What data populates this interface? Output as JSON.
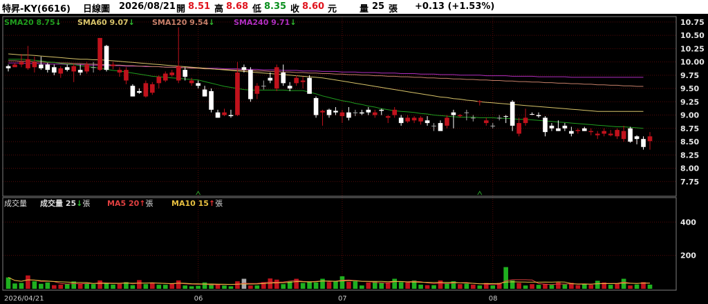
{
  "header": {
    "name": "特昇-KY(6616)",
    "chart_kind": "日線圖",
    "date": "2026/08/21",
    "open_label": "開",
    "open": "8.51",
    "high_label": "高",
    "high": "8.68",
    "low_label": "低",
    "low": "8.35",
    "close_label": "收",
    "close": "8.60",
    "unit": "元",
    "volume_label": "量",
    "volume": "25",
    "volume_unit": "張",
    "change": "+0.13 (+1.53%)"
  },
  "colors": {
    "up": "#c0121c",
    "down": "#ffffff",
    "flat": "#aaaaaa",
    "vol_up": "#c0121c",
    "vol_down": "#1fb01f",
    "sma20": "#1f9e1f",
    "sma60": "#d8c46a",
    "sma120": "#c8806a",
    "sma240": "#b02ec0",
    "ma5": "#e04040",
    "ma10": "#e8c040",
    "grid": "#5a0a0a",
    "frame": "#808080"
  },
  "legend_price": [
    {
      "label": "SMA20",
      "value": "8.75",
      "arrow": "down"
    },
    {
      "label": "SMA60",
      "value": "9.07",
      "arrow": "down"
    },
    {
      "label": "SMA120",
      "value": "9.54",
      "arrow": "down"
    },
    {
      "label": "SMA240",
      "value": "9.71",
      "arrow": "down"
    }
  ],
  "legend_volume": {
    "title": "成交量",
    "items": [
      {
        "label": "成交量",
        "value": "25",
        "arrow": "down",
        "unit": "張"
      },
      {
        "label": "MA5",
        "value": "20",
        "arrow": "up",
        "unit": "張"
      },
      {
        "label": "MA10",
        "value": "15",
        "arrow": "up",
        "unit": "張"
      }
    ]
  },
  "chart_data": {
    "type": "candlestick",
    "x_labels": [
      {
        "index": 0,
        "label": "2026/04/21"
      },
      {
        "index": 29,
        "label": "06"
      },
      {
        "index": 51,
        "label": "07"
      },
      {
        "index": 74,
        "label": "08"
      }
    ],
    "price_ylim": [
      7.5,
      10.8
    ],
    "price_ticks": [
      7.75,
      8.0,
      8.25,
      8.5,
      8.75,
      9.0,
      9.25,
      9.5,
      9.75,
      10.0,
      10.25,
      10.5,
      10.75
    ],
    "volume_ylim": [
      0,
      480
    ],
    "volume_ticks": [
      200,
      400
    ],
    "candles": [
      [
        9.92,
        9.95,
        9.82,
        9.88
      ],
      [
        9.9,
        9.98,
        9.92,
        9.95
      ],
      [
        9.95,
        10.15,
        9.9,
        10.0
      ],
      [
        9.88,
        10.3,
        9.85,
        10.05
      ],
      [
        9.9,
        10.1,
        9.8,
        10.0
      ],
      [
        9.95,
        10.1,
        9.85,
        9.88
      ],
      [
        9.95,
        9.98,
        9.8,
        9.85
      ],
      [
        9.9,
        9.95,
        9.75,
        9.8
      ],
      [
        9.78,
        9.92,
        9.7,
        9.88
      ],
      [
        9.9,
        9.95,
        9.82,
        9.85
      ],
      [
        9.82,
        9.97,
        9.62,
        9.92
      ],
      [
        9.85,
        9.95,
        9.75,
        9.8
      ],
      [
        9.82,
        10.0,
        9.78,
        9.95
      ],
      [
        9.9,
        10.0,
        9.8,
        9.9
      ],
      [
        9.85,
        10.45,
        9.83,
        10.45
      ],
      [
        10.3,
        10.32,
        9.82,
        9.85
      ],
      [
        9.92,
        10.0,
        9.86,
        9.95
      ],
      [
        9.8,
        9.9,
        9.72,
        9.85
      ],
      [
        9.65,
        9.9,
        9.58,
        9.85
      ],
      [
        9.55,
        9.58,
        9.35,
        9.35
      ],
      [
        9.45,
        9.5,
        9.4,
        9.42
      ],
      [
        9.35,
        9.65,
        9.33,
        9.6
      ],
      [
        9.42,
        9.62,
        9.38,
        9.58
      ],
      [
        9.6,
        9.75,
        9.5,
        9.72
      ],
      [
        9.65,
        9.82,
        9.62,
        9.78
      ],
      [
        9.75,
        9.85,
        9.72,
        9.8
      ],
      [
        9.65,
        10.65,
        9.6,
        9.92
      ],
      [
        9.85,
        9.9,
        9.65,
        9.72
      ],
      [
        9.6,
        9.7,
        9.55,
        9.65
      ],
      [
        9.6,
        9.65,
        9.5,
        9.55
      ],
      [
        9.48,
        9.55,
        9.35,
        9.35
      ],
      [
        9.45,
        9.5,
        9.05,
        9.1
      ],
      [
        9.05,
        9.1,
        8.95,
        8.95
      ],
      [
        9.0,
        9.12,
        8.98,
        9.05
      ],
      [
        9.0,
        9.1,
        8.95,
        8.98
      ],
      [
        9.0,
        10.0,
        8.98,
        9.8
      ],
      [
        9.9,
        9.95,
        9.8,
        9.85
      ],
      [
        9.85,
        9.9,
        9.25,
        9.3
      ],
      [
        9.4,
        9.6,
        9.3,
        9.55
      ],
      [
        9.55,
        9.65,
        9.48,
        9.55
      ],
      [
        9.7,
        9.8,
        9.6,
        9.65
      ],
      [
        9.5,
        9.95,
        9.45,
        9.9
      ],
      [
        9.8,
        9.95,
        9.55,
        9.6
      ],
      [
        9.55,
        9.62,
        9.45,
        9.5
      ],
      [
        9.6,
        9.75,
        9.55,
        9.7
      ],
      [
        9.62,
        9.72,
        9.5,
        9.65
      ],
      [
        9.7,
        9.75,
        9.4,
        9.4
      ],
      [
        9.32,
        9.35,
        8.95,
        9.0
      ],
      [
        9.05,
        9.1,
        8.8,
        9.08
      ],
      [
        9.1,
        9.12,
        8.95,
        9.0
      ],
      [
        9.08,
        9.15,
        9.0,
        9.05
      ],
      [
        8.98,
        9.1,
        8.85,
        9.05
      ],
      [
        9.05,
        9.15,
        8.9,
        8.95
      ],
      [
        9.05,
        9.1,
        8.98,
        9.05
      ],
      [
        9.05,
        9.1,
        9.0,
        9.03
      ],
      [
        9.1,
        9.15,
        9.0,
        9.05
      ],
      [
        9.0,
        9.1,
        8.95,
        9.05
      ],
      [
        9.1,
        9.12,
        9.0,
        9.08
      ],
      [
        8.95,
        9.0,
        8.85,
        8.98
      ],
      [
        9.0,
        9.15,
        8.95,
        9.1
      ],
      [
        8.95,
        9.0,
        8.8,
        8.85
      ],
      [
        8.88,
        9.0,
        8.85,
        8.95
      ],
      [
        8.9,
        8.98,
        8.85,
        8.95
      ],
      [
        8.88,
        8.98,
        8.82,
        8.95
      ],
      [
        8.9,
        8.98,
        8.8,
        8.85
      ],
      [
        8.8,
        8.85,
        8.7,
        8.8
      ],
      [
        8.85,
        8.9,
        8.75,
        8.7
      ],
      [
        8.8,
        9.0,
        8.75,
        8.95
      ],
      [
        9.05,
        9.1,
        8.75,
        9.0
      ],
      [
        8.98,
        9.02,
        8.95,
        9.0
      ],
      [
        9.05,
        9.1,
        8.9,
        9.05
      ],
      [
        8.95,
        9.0,
        8.88,
        8.95
      ],
      [
        9.25,
        9.28,
        9.18,
        9.26
      ],
      [
        8.85,
        8.95,
        8.8,
        8.9
      ],
      [
        8.8,
        8.85,
        8.75,
        8.8
      ],
      [
        8.95,
        9.0,
        8.9,
        8.95
      ],
      [
        8.98,
        9.0,
        8.85,
        8.97
      ],
      [
        9.25,
        9.28,
        8.7,
        8.8
      ],
      [
        8.65,
        8.95,
        8.6,
        8.85
      ],
      [
        8.85,
        9.12,
        8.8,
        8.95
      ],
      [
        9.02,
        9.05,
        9.0,
        9.01
      ],
      [
        9.0,
        9.05,
        8.95,
        8.98
      ],
      [
        8.95,
        8.98,
        8.6,
        8.68
      ],
      [
        8.8,
        8.85,
        8.7,
        8.75
      ],
      [
        8.75,
        8.9,
        8.7,
        8.7
      ],
      [
        8.8,
        8.85,
        8.7,
        8.75
      ],
      [
        8.7,
        8.78,
        8.6,
        8.65
      ],
      [
        8.7,
        8.75,
        8.65,
        8.72
      ],
      [
        8.75,
        8.78,
        8.7,
        8.7
      ],
      [
        8.68,
        8.75,
        8.62,
        8.7
      ],
      [
        8.62,
        8.7,
        8.55,
        8.65
      ],
      [
        8.65,
        8.75,
        8.6,
        8.7
      ],
      [
        8.62,
        8.72,
        8.6,
        8.65
      ],
      [
        8.6,
        8.75,
        8.55,
        8.72
      ],
      [
        8.55,
        8.8,
        8.5,
        8.7
      ],
      [
        8.75,
        8.78,
        8.48,
        8.5
      ],
      [
        8.6,
        8.62,
        8.45,
        8.55
      ],
      [
        8.55,
        8.6,
        8.35,
        8.4
      ],
      [
        8.51,
        8.68,
        8.35,
        8.6
      ]
    ],
    "volumes": [
      68,
      32,
      35,
      80,
      45,
      30,
      38,
      22,
      25,
      28,
      44,
      30,
      32,
      28,
      50,
      35,
      25,
      30,
      40,
      22,
      52,
      28,
      38,
      24,
      24,
      32,
      50,
      20,
      15,
      18,
      38,
      30,
      25,
      20,
      15,
      45,
      60,
      20,
      20,
      40,
      62,
      55,
      28,
      45,
      60,
      35,
      45,
      38,
      60,
      40,
      45,
      75,
      42,
      45,
      20,
      38,
      45,
      35,
      38,
      60,
      40,
      38,
      50,
      25,
      22,
      22,
      50,
      35,
      45,
      28,
      30,
      25,
      20,
      35,
      20,
      35,
      130,
      50,
      35,
      20,
      28,
      24,
      30,
      24,
      38,
      26,
      36,
      22,
      30,
      24,
      48,
      38,
      24,
      30,
      60,
      20,
      26,
      40,
      25
    ],
    "volume_colors": [
      "green",
      "green",
      "green",
      "red",
      "green",
      "green",
      "green",
      "red",
      "red",
      "green",
      "green",
      "red",
      "green",
      "green",
      "red",
      "green",
      "green",
      "red",
      "green",
      "green",
      "red",
      "green",
      "red",
      "green",
      "green",
      "red",
      "red",
      "green",
      "green",
      "green",
      "green",
      "green",
      "red",
      "green",
      "green",
      "red",
      "flat",
      "red",
      "green",
      "red",
      "red",
      "red",
      "green",
      "green",
      "red",
      "green",
      "green",
      "green",
      "green",
      "red",
      "green",
      "green",
      "red",
      "green",
      "green",
      "red",
      "green",
      "green",
      "red",
      "green",
      "green",
      "red",
      "green",
      "green",
      "red",
      "green",
      "red",
      "green",
      "green",
      "red",
      "green",
      "red",
      "green",
      "red",
      "green",
      "red",
      "green",
      "green",
      "red",
      "green",
      "red",
      "green",
      "red",
      "green",
      "red",
      "green",
      "red",
      "red",
      "green",
      "red",
      "green",
      "red",
      "green",
      "red",
      "green",
      "red",
      "green",
      "red",
      "green",
      "red"
    ],
    "sma20": [
      10.05,
      10.05,
      10.05,
      10.04,
      10.03,
      10.02,
      10.0,
      9.99,
      9.97,
      9.96,
      9.95,
      9.93,
      9.91,
      9.9,
      9.88,
      9.86,
      9.84,
      9.83,
      9.81,
      9.79,
      9.77,
      9.75,
      9.73,
      9.72,
      9.71,
      9.7,
      9.69,
      9.68,
      9.67,
      9.66,
      9.63,
      9.6,
      9.57,
      9.54,
      9.52,
      9.5,
      9.48,
      9.47,
      9.47,
      9.47,
      9.47,
      9.47,
      9.47,
      9.46,
      9.46,
      9.46,
      9.43,
      9.4,
      9.36,
      9.33,
      9.3,
      9.27,
      9.25,
      9.22,
      9.2,
      9.17,
      9.15,
      9.12,
      9.1,
      9.08,
      9.07,
      9.06,
      9.05,
      9.03,
      9.02,
      9.0,
      8.99,
      8.98,
      8.97,
      8.96,
      8.96,
      8.96,
      8.95,
      8.95,
      8.95,
      8.94,
      8.94,
      8.93,
      8.92,
      8.92,
      8.91,
      8.9,
      8.89,
      8.88,
      8.87,
      8.86,
      8.85,
      8.84,
      8.83,
      8.82,
      8.81,
      8.8,
      8.79,
      8.78,
      8.78,
      8.77,
      8.76,
      8.75
    ],
    "sma60": [
      10.15,
      10.14,
      10.13,
      10.13,
      10.12,
      10.11,
      10.1,
      10.09,
      10.08,
      10.07,
      10.06,
      10.05,
      10.05,
      10.04,
      10.04,
      10.03,
      10.02,
      10.01,
      10.0,
      9.99,
      9.98,
      9.97,
      9.96,
      9.95,
      9.94,
      9.93,
      9.92,
      9.91,
      9.9,
      9.89,
      9.88,
      9.87,
      9.86,
      9.85,
      9.84,
      9.83,
      9.82,
      9.81,
      9.8,
      9.79,
      9.78,
      9.77,
      9.76,
      9.75,
      9.74,
      9.73,
      9.72,
      9.71,
      9.7,
      9.68,
      9.66,
      9.64,
      9.62,
      9.6,
      9.58,
      9.56,
      9.54,
      9.52,
      9.5,
      9.48,
      9.46,
      9.44,
      9.42,
      9.4,
      9.38,
      9.36,
      9.34,
      9.33,
      9.31,
      9.3,
      9.28,
      9.27,
      9.25,
      9.24,
      9.23,
      9.22,
      9.21,
      9.2,
      9.19,
      9.18,
      9.17,
      9.16,
      9.15,
      9.14,
      9.13,
      9.12,
      9.11,
      9.1,
      9.09,
      9.08,
      9.07,
      9.07,
      9.07,
      9.07,
      9.07,
      9.07,
      9.07,
      9.07
    ],
    "sma120": [
      10.02,
      10.02,
      10.01,
      10.01,
      10.0,
      10.0,
      9.99,
      9.99,
      9.98,
      9.98,
      9.97,
      9.97,
      9.96,
      9.96,
      9.95,
      9.95,
      9.94,
      9.94,
      9.93,
      9.93,
      9.92,
      9.92,
      9.91,
      9.91,
      9.9,
      9.9,
      9.89,
      9.89,
      9.88,
      9.88,
      9.87,
      9.87,
      9.86,
      9.86,
      9.85,
      9.85,
      9.84,
      9.84,
      9.83,
      9.83,
      9.82,
      9.82,
      9.81,
      9.81,
      9.8,
      9.8,
      9.79,
      9.79,
      9.78,
      9.78,
      9.77,
      9.77,
      9.76,
      9.76,
      9.75,
      9.75,
      9.74,
      9.74,
      9.73,
      9.73,
      9.72,
      9.72,
      9.71,
      9.71,
      9.7,
      9.7,
      9.69,
      9.69,
      9.68,
      9.68,
      9.67,
      9.67,
      9.66,
      9.66,
      9.65,
      9.65,
      9.64,
      9.64,
      9.63,
      9.63,
      9.62,
      9.62,
      9.61,
      9.61,
      9.6,
      9.6,
      9.59,
      9.59,
      9.58,
      9.58,
      9.57,
      9.57,
      9.56,
      9.56,
      9.55,
      9.55,
      9.54,
      9.54
    ],
    "sma240": [
      9.98,
      9.98,
      9.98,
      9.97,
      9.97,
      9.97,
      9.96,
      9.96,
      9.96,
      9.95,
      9.95,
      9.95,
      9.94,
      9.94,
      9.94,
      9.93,
      9.93,
      9.93,
      9.92,
      9.92,
      9.92,
      9.91,
      9.91,
      9.91,
      9.9,
      9.9,
      9.9,
      9.89,
      9.89,
      9.89,
      9.88,
      9.88,
      9.88,
      9.87,
      9.87,
      9.87,
      9.86,
      9.86,
      9.86,
      9.85,
      9.85,
      9.85,
      9.84,
      9.84,
      9.84,
      9.83,
      9.83,
      9.83,
      9.82,
      9.82,
      9.82,
      9.81,
      9.81,
      9.81,
      9.8,
      9.8,
      9.8,
      9.79,
      9.79,
      9.79,
      9.78,
      9.78,
      9.78,
      9.77,
      9.77,
      9.77,
      9.76,
      9.76,
      9.76,
      9.75,
      9.75,
      9.75,
      9.75,
      9.74,
      9.74,
      9.74,
      9.74,
      9.73,
      9.73,
      9.73,
      9.73,
      9.72,
      9.72,
      9.72,
      9.72,
      9.72,
      9.71,
      9.71,
      9.71,
      9.71,
      9.71,
      9.71,
      9.71,
      9.71,
      9.71,
      9.71,
      9.71,
      9.71
    ]
  }
}
